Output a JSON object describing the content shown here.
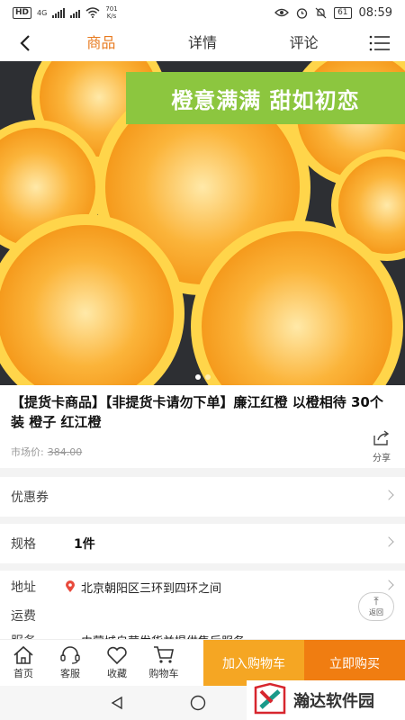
{
  "status": {
    "hd": "HD",
    "net": "4G",
    "speed_top": "701",
    "speed_unit": "K/s",
    "battery": "61",
    "time": "08:59"
  },
  "nav": {
    "tabs": [
      {
        "label": "商品"
      },
      {
        "label": "详情"
      },
      {
        "label": "评论"
      }
    ]
  },
  "hero": {
    "banner_text": "橙意满满  甜如初恋"
  },
  "product": {
    "title": "【提货卡商品】【非提货卡请勿下单】廉江红橙 以橙相待 30个装 橙子 红江橙",
    "market_price_label": "市场价:",
    "market_price": "384.00",
    "share_label": "分享"
  },
  "rows": {
    "coupon_label": "优惠券",
    "spec_label": "规格",
    "spec_value": "1件",
    "address_label": "地址",
    "address_value": "北京朝阳区三环到四环之间",
    "shipping_label": "运费",
    "service_label": "服务",
    "service_value": "由蒙城自营发货并提供售后服务"
  },
  "backtop_label": "返回",
  "bottom": {
    "home": "首页",
    "service": "客服",
    "favorite": "收藏",
    "cart": "购物车",
    "add_cart": "加入购物车",
    "buy_now": "立即购买"
  },
  "watermark": {
    "text": "瀚达软件园"
  },
  "colors": {
    "accent": "#e87a1e",
    "cart_button": "#f5a623",
    "buy_button": "#f07d11",
    "banner": "#8cc63f"
  }
}
